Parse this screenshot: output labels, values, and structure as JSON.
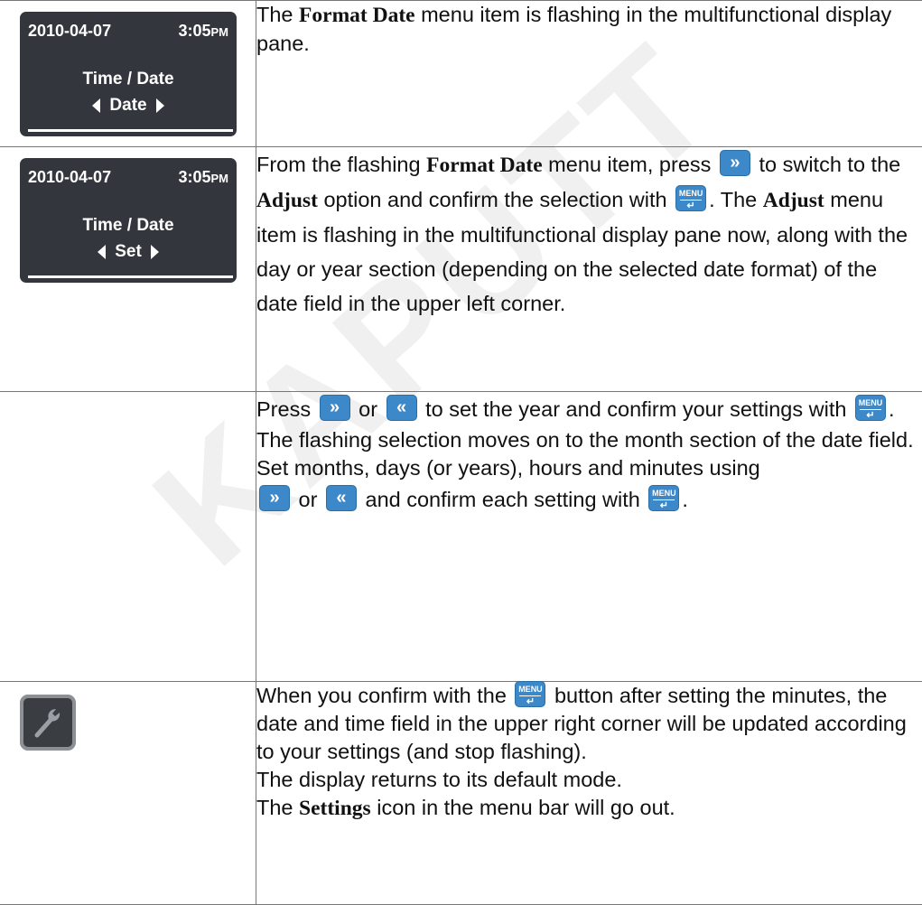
{
  "watermark": "KAPUTT",
  "icons": {
    "forward": "»",
    "back": "«",
    "menu_label": "MENU",
    "enter": "↵"
  },
  "rows": [
    {
      "display": {
        "date": "2010-04-07",
        "time": "3:05",
        "ampm": "PM",
        "title": "Time / Date",
        "item": "Date"
      },
      "text": {
        "a": "The ",
        "b": "Format Date",
        "c": " menu item is flashing in the multifunctional display pane."
      }
    },
    {
      "display": {
        "date": "2010-04-07",
        "time": "3:05",
        "ampm": "PM",
        "title": "Time / Date",
        "item": "Set"
      },
      "text": {
        "a": "From the flashing ",
        "b": "Format Date",
        "c": " menu item, press ",
        "d": " to switch to the ",
        "e": "Adjust",
        "f": " option and confirm the selection with ",
        "g": ". The ",
        "h": "Adjust",
        "i": " menu item is flashing in the multifunctional display pane now, along with the day or year section (depending on the selected date format) of the date field in the upper left corner."
      }
    },
    {
      "text": {
        "a": "Press ",
        "b": " or ",
        "c": " to set the year and confirm your settings with ",
        "d": ".",
        "e": "The flashing selection moves on to the month section of the date field.",
        "f": "Set months, days (or years), hours and minutes using",
        "g": " or ",
        "h": " and confirm each setting with ",
        "i": "."
      }
    },
    {
      "icon": "wrench-icon",
      "text": {
        "a": "When you confirm with the ",
        "b": " button after setting the minutes, the date and time field in the upper right corner will be updated according to your settings (and stop flashing).",
        "c": "The display returns to its default mode.",
        "d": "The ",
        "e": "Settings",
        "f": " icon in the menu bar will go out."
      }
    }
  ]
}
